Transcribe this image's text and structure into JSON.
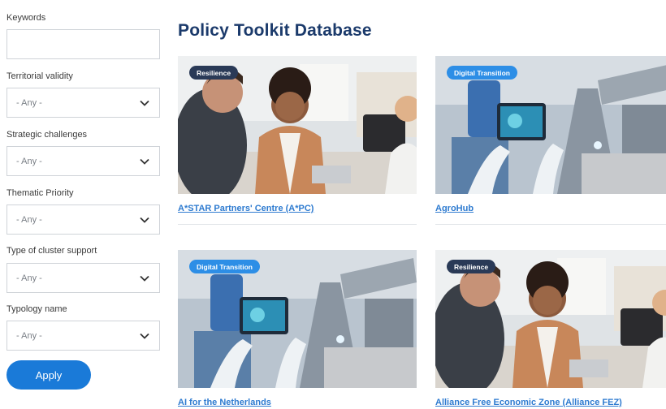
{
  "filters": {
    "keywords": {
      "label": "Keywords",
      "value": "",
      "placeholder": ""
    },
    "territorial": {
      "label": "Territorial validity",
      "value": "- Any -"
    },
    "strategic": {
      "label": "Strategic challenges",
      "value": "- Any -"
    },
    "thematic": {
      "label": "Thematic Priority",
      "value": "- Any -"
    },
    "cluster_support": {
      "label": "Type of cluster support",
      "value": "- Any -"
    },
    "typology": {
      "label": "Typology name",
      "value": "- Any -"
    },
    "apply_label": "Apply"
  },
  "main": {
    "title": "Policy Toolkit Database",
    "cards": [
      {
        "badge": "Resilience",
        "title": "A*STAR Partners' Centre (A*PC)"
      },
      {
        "badge": "Digital Transition",
        "title": "AgroHub"
      },
      {
        "badge": "Digital Transition",
        "title": "AI for the Netherlands"
      },
      {
        "badge": "Resilience",
        "title": "Alliance Free Economic Zone (Alliance FEZ)"
      }
    ]
  },
  "colors": {
    "title": "#1b3a6b",
    "link": "#2e7bd0",
    "apply_button": "#1a7ad8",
    "badge_resilience": "#2a3a57",
    "badge_digital": "#2d8ee6"
  }
}
